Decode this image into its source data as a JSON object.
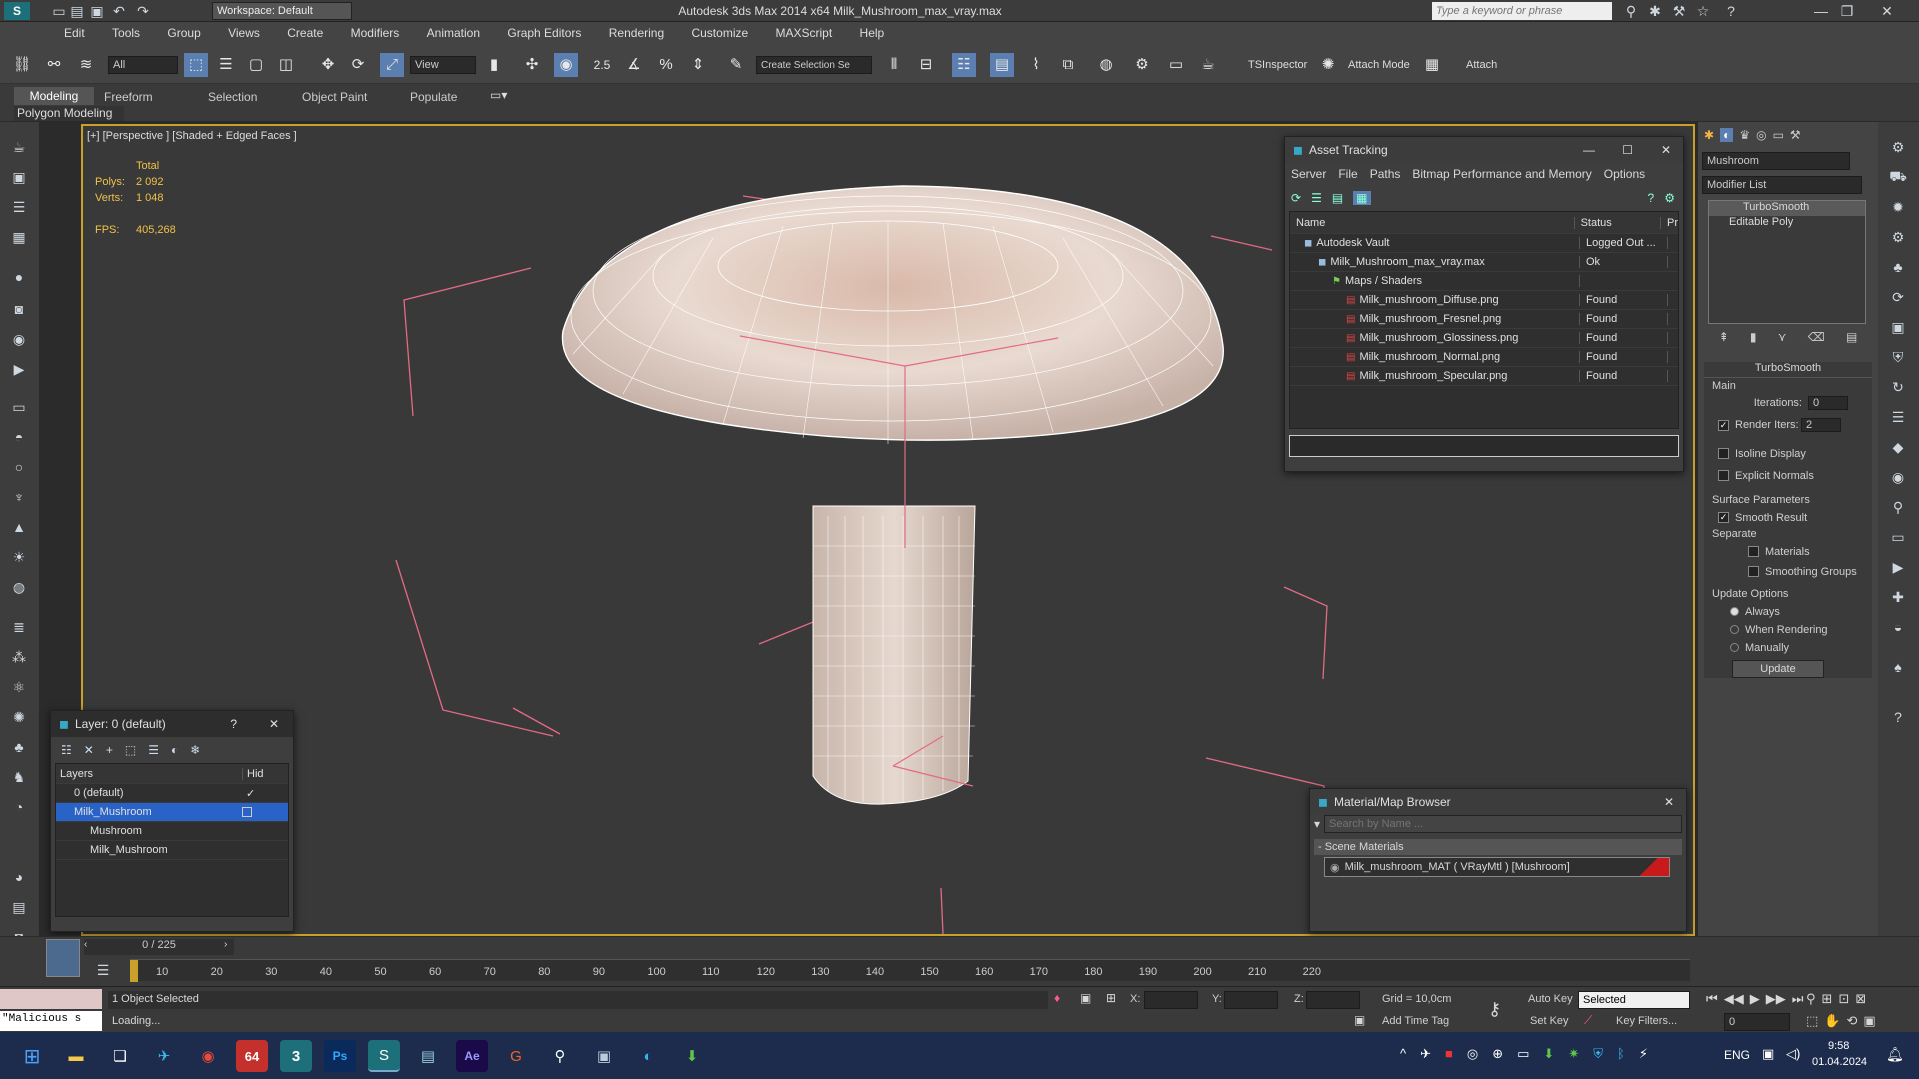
{
  "app": {
    "title": "Autodesk 3ds Max  2014 x64    Milk_Mushroom_max_vray.max",
    "workspace": "Workspace: Default",
    "search_placeholder": "Type a keyword or phrase"
  },
  "menu": [
    "Edit",
    "Tools",
    "Group",
    "Views",
    "Create",
    "Modifiers",
    "Animation",
    "Graph Editors",
    "Rendering",
    "Customize",
    "MAXScript",
    "Help"
  ],
  "toolbar": {
    "selection_filter": "All",
    "ref_coord": "View",
    "selection_set": "Create Selection Se",
    "snap_value": "2.5",
    "ts_inspector": "TSInspector",
    "attach_mode": "Attach Mode",
    "attach": "Attach"
  },
  "ribbon": {
    "tabs": [
      "Modeling",
      "Freeform",
      "Selection",
      "Object Paint",
      "Populate"
    ],
    "subtitle": "Polygon Modeling"
  },
  "viewport": {
    "label": "[+] [Perspective ] [Shaded + Edged Faces ]",
    "stats": {
      "total_label": "Total",
      "polys_label": "Polys:",
      "polys": "2 092",
      "verts_label": "Verts:",
      "verts": "1 048",
      "fps_label": "FPS:",
      "fps": "405,268"
    }
  },
  "asset_tracking": {
    "title": "Asset Tracking",
    "menu": [
      "Server",
      "File",
      "Paths",
      "Bitmap Performance and Memory",
      "Options"
    ],
    "columns": [
      "Name",
      "Status",
      "Pr"
    ],
    "rows": [
      {
        "name": "Autodesk Vault",
        "status": "Logged Out ...",
        "indent": 1
      },
      {
        "name": "Milk_Mushroom_max_vray.max",
        "status": "Ok",
        "indent": 2
      },
      {
        "name": "Maps / Shaders",
        "status": "",
        "indent": 3
      },
      {
        "name": "Milk_mushroom_Diffuse.png",
        "status": "Found",
        "indent": 4
      },
      {
        "name": "Milk_mushroom_Fresnel.png",
        "status": "Found",
        "indent": 4
      },
      {
        "name": "Milk_mushroom_Glossiness.png",
        "status": "Found",
        "indent": 4
      },
      {
        "name": "Milk_mushroom_Normal.png",
        "status": "Found",
        "indent": 4
      },
      {
        "name": "Milk_mushroom_Specular.png",
        "status": "Found",
        "indent": 4
      }
    ]
  },
  "layer_panel": {
    "title": "Layer: 0 (default)",
    "col_layers": "Layers",
    "col_hide": "Hid",
    "rows": [
      "0 (default)",
      "Milk_Mushroom",
      "Mushroom",
      "Milk_Mushroom"
    ]
  },
  "material_browser": {
    "title": "Material/Map Browser",
    "search_placeholder": "Search by Name ...",
    "group": "- Scene Materials",
    "material": "Milk_mushroom_MAT  ( VRayMtl )  [Mushroom]"
  },
  "command_panel": {
    "object_name": "Mushroom",
    "modifier_list": "Modifier List",
    "stack": [
      "TurboSmooth",
      "Editable Poly"
    ],
    "turbosmooth": {
      "header": "TurboSmooth",
      "main": "Main",
      "iterations_label": "Iterations:",
      "iterations": "0",
      "render_iters_label": "Render Iters:",
      "render_iters": "2",
      "isoline": "Isoline Display",
      "explicit": "Explicit Normals",
      "surface": "Surface Parameters",
      "smooth_result": "Smooth Result",
      "separate": "Separate",
      "materials": "Materials",
      "smoothing_groups": "Smoothing Groups",
      "update_options": "Update Options",
      "always": "Always",
      "when_rendering": "When Rendering",
      "manually": "Manually",
      "update_btn": "Update"
    }
  },
  "timeline": {
    "frame": "0 / 225",
    "ticks": [
      "10",
      "20",
      "30",
      "40",
      "50",
      "60",
      "70",
      "80",
      "90",
      "100",
      "110",
      "120",
      "130",
      "140",
      "150",
      "160",
      "170",
      "180",
      "190",
      "200",
      "210",
      "220"
    ]
  },
  "status": {
    "maxscript": "\"Malicious s",
    "selected": "1 Object Selected",
    "loading": "Loading...",
    "x": "X:",
    "y": "Y:",
    "z": "Z:",
    "grid": "Grid = 10,0cm",
    "add_time_tag": "Add Time Tag",
    "auto_key": "Auto Key",
    "set_key": "Set Key",
    "key_mode": "Selected",
    "key_filters": "Key Filters...",
    "frame_field": "0"
  },
  "taskbar": {
    "lang": "ENG",
    "time": "9:58",
    "date": "01.04.2024",
    "badge": "64"
  }
}
